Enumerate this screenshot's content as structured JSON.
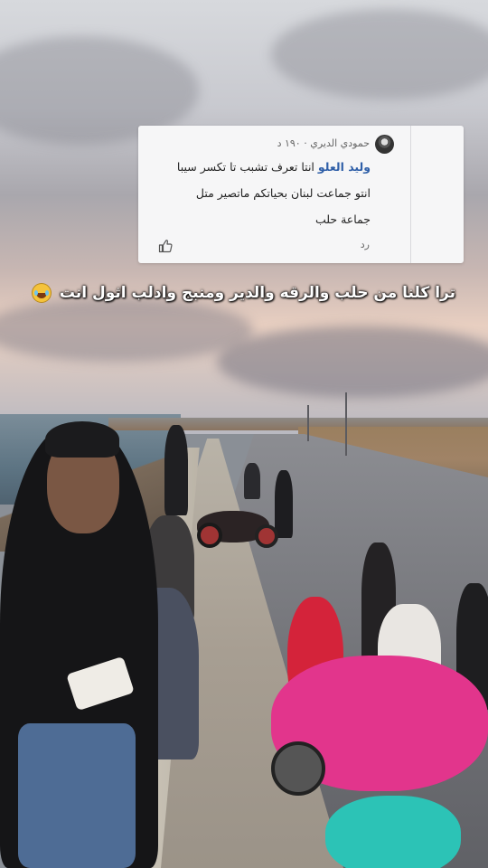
{
  "comment": {
    "author": "حمودي الديري",
    "time": "١٩٠ د",
    "mention": "وليد العلو",
    "text": "انتا تعرف تشبب تا تكسر سيبا انتو جماعت لبنان بحياتكم ماتصير متل جماعة حلب",
    "reply_label": "رد",
    "like_icon": "thumbs-up-icon",
    "avatar_icon": "avatar-icon"
  },
  "caption": {
    "text": "ترا كلنا من حلب والرقه والدير ومنبج وادلب  اثول انت",
    "emoji": "face-with-tears-of-joy-icon"
  },
  "colors": {
    "mention": "#2f5fa8",
    "card_bg": "#f6f6f7",
    "caption_text": "#ffffff"
  }
}
